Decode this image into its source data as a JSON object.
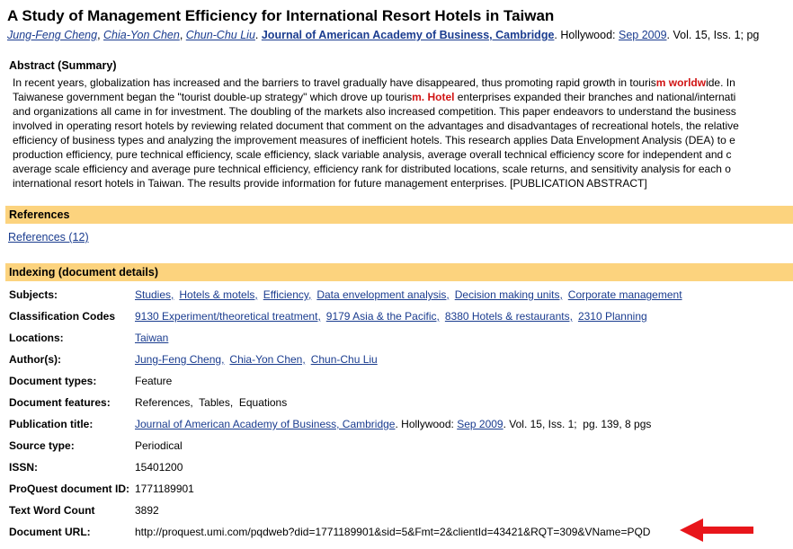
{
  "title": "A Study of Management Efficiency for International Resort Hotels in Taiwan",
  "citation": {
    "authors": [
      "Jung-Feng Cheng",
      "Chia-Yon Chen",
      "Chun-Chu Liu"
    ],
    "journal": "Journal of American Academy of Business, Cambridge",
    "place": "Hollywood:",
    "date": "Sep 2009",
    "rest": "Vol. 15, Iss. 1; pg"
  },
  "abstract": {
    "heading": "Abstract (Summary)",
    "lines": [
      {
        "pre": "In recent years, globalization has increased and the barriers to travel gradually have disappeared, thus promoting rapid growth in touris",
        "hl": "m worldw",
        "post": "ide. In"
      },
      {
        "pre": "Taiwanese government began the \"tourist double-up strategy\" which drove up touris",
        "hl": "m. Hotel",
        "post": " enterprises expanded their branches and national/internati"
      },
      {
        "pre": "and organizations all came in for investment. The doubling of the markets also increased competition. This paper endeavors to understand the business",
        "hl": "",
        "post": ""
      },
      {
        "pre": "involved in operating resort hotels by reviewing related document that comment on the advantages and disadvantages of recreational hotels, the relative",
        "hl": "",
        "post": ""
      },
      {
        "pre": "efficiency of business types and analyzing the improvement measures of inefficient hotels. This research applies Data Envelopment Analysis (DEA) to e",
        "hl": "",
        "post": ""
      },
      {
        "pre": "production efficiency, pure technical efficiency, scale efficiency, slack variable analysis, average overall technical efficiency score for independent and c",
        "hl": "",
        "post": ""
      },
      {
        "pre": "average scale efficiency and average pure technical efficiency, efficiency rank for distributed locations, scale returns, and sensitivity analysis for each o",
        "hl": "",
        "post": ""
      },
      {
        "pre": "international resort hotels in Taiwan. The results provide information for future management enterprises. [PUBLICATION ABSTRACT]",
        "hl": "",
        "post": ""
      }
    ]
  },
  "references": {
    "heading": "References",
    "link": "References (12)"
  },
  "indexing": {
    "heading": "Indexing (document details)",
    "subjects_label": "Subjects:",
    "subjects": [
      "Studies,",
      "Hotels & motels,",
      "Efficiency,",
      "Data envelopment analysis,",
      "Decision making units,",
      "Corporate management"
    ],
    "classification_label": "Classification Codes",
    "classification": [
      "9130 Experiment/theoretical treatment,",
      "9179 Asia & the Pacific,",
      "8380 Hotels & restaurants,",
      "2310 Planning"
    ],
    "locations_label": "Locations:",
    "locations": [
      "Taiwan"
    ],
    "authors_label": "Author(s):",
    "authors": [
      "Jung-Feng Cheng,",
      "Chia-Yon Chen,",
      "Chun-Chu Liu"
    ],
    "doctypes_label": "Document types:",
    "doctypes": "Feature",
    "docfeatures_label": "Document features:",
    "docfeatures": "References,  Tables,  Equations",
    "pubtitle_label": "Publication title:",
    "pubtitle_link": "Journal of American Academy of Business, Cambridge",
    "pubtitle_place": ". Hollywood:",
    "pubtitle_date": "Sep 2009",
    "pubtitle_rest": ". Vol. 15, Iss. 1;  pg. 139, 8 pgs",
    "sourcetype_label": "Source type:",
    "sourcetype": "Periodical",
    "issn_label": "ISSN:",
    "issn": "15401200",
    "pqid_label": "ProQuest document ID:",
    "pqid": "1771189901",
    "wordcount_label": "Text Word Count",
    "wordcount": "3892",
    "docurl_label": "Document URL:",
    "docurl": "http://proquest.umi.com/pqdweb?did=1771189901&sid=5&Fmt=2&clientId=43421&RQT=309&VName=PQD"
  },
  "colors": {
    "section_bar": "#fcd37e",
    "highlight": "#d01414",
    "link": "#1a3c8f",
    "arrow": "#e8161b"
  }
}
